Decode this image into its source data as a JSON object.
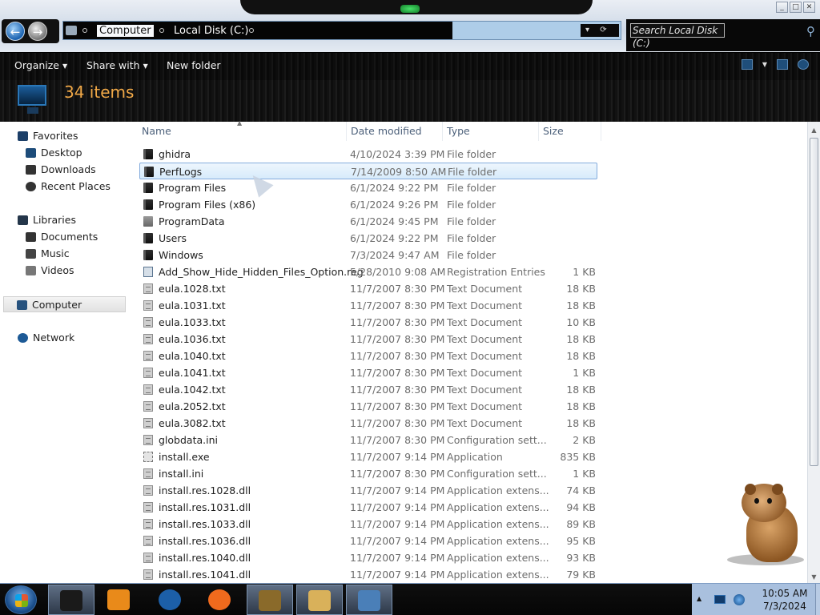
{
  "window": {
    "controls": {
      "minimize": "_",
      "maximize": "□",
      "close": "✕"
    }
  },
  "address": {
    "crumb_computer": "Computer",
    "crumb_drive": "Local Disk (C:)",
    "dropdown_glyph": "▾",
    "refresh_glyph": "⟳"
  },
  "search": {
    "placeholder": "Search Local Disk (C:)",
    "icon": "search-icon"
  },
  "toolbar": {
    "organize_label": "Organize",
    "share_label": "Share with",
    "newfolder_label": "New folder",
    "item_count": "34 items"
  },
  "nav": {
    "favorites": "Favorites",
    "desktop": "Desktop",
    "downloads": "Downloads",
    "recent_places": "Recent Places",
    "libraries": "Libraries",
    "documents": "Documents",
    "music": "Music",
    "videos": "Videos",
    "computer": "Computer",
    "network": "Network"
  },
  "columns": {
    "name": "Name",
    "date": "Date modified",
    "type": "Type",
    "size": "Size"
  },
  "files": [
    {
      "name": "ghidra",
      "date": "4/10/2024 3:39 PM",
      "type": "File folder",
      "size": "",
      "icon": "folder"
    },
    {
      "name": "PerfLogs",
      "date": "7/14/2009 8:50 AM",
      "type": "File folder",
      "size": "",
      "icon": "folder",
      "selected": true
    },
    {
      "name": "Program Files",
      "date": "6/1/2024 9:22 PM",
      "type": "File folder",
      "size": "",
      "icon": "folder"
    },
    {
      "name": "Program Files (x86)",
      "date": "6/1/2024 9:26 PM",
      "type": "File folder",
      "size": "",
      "icon": "folder"
    },
    {
      "name": "ProgramData",
      "date": "6/1/2024 9:45 PM",
      "type": "File folder",
      "size": "",
      "icon": "folderlight"
    },
    {
      "name": "Users",
      "date": "6/1/2024 9:22 PM",
      "type": "File folder",
      "size": "",
      "icon": "folder"
    },
    {
      "name": "Windows",
      "date": "7/3/2024 9:47 AM",
      "type": "File folder",
      "size": "",
      "icon": "folder"
    },
    {
      "name": "Add_Show_Hide_Hidden_Files_Option.reg",
      "date": "5/28/2010 9:08 AM",
      "type": "Registration Entries",
      "size": "1 KB",
      "icon": "reg"
    },
    {
      "name": "eula.1028.txt",
      "date": "11/7/2007 8:30 PM",
      "type": "Text Document",
      "size": "18 KB",
      "icon": "doc"
    },
    {
      "name": "eula.1031.txt",
      "date": "11/7/2007 8:30 PM",
      "type": "Text Document",
      "size": "18 KB",
      "icon": "doc"
    },
    {
      "name": "eula.1033.txt",
      "date": "11/7/2007 8:30 PM",
      "type": "Text Document",
      "size": "10 KB",
      "icon": "doc"
    },
    {
      "name": "eula.1036.txt",
      "date": "11/7/2007 8:30 PM",
      "type": "Text Document",
      "size": "18 KB",
      "icon": "doc"
    },
    {
      "name": "eula.1040.txt",
      "date": "11/7/2007 8:30 PM",
      "type": "Text Document",
      "size": "18 KB",
      "icon": "doc"
    },
    {
      "name": "eula.1041.txt",
      "date": "11/7/2007 8:30 PM",
      "type": "Text Document",
      "size": "1 KB",
      "icon": "doc"
    },
    {
      "name": "eula.1042.txt",
      "date": "11/7/2007 8:30 PM",
      "type": "Text Document",
      "size": "18 KB",
      "icon": "doc"
    },
    {
      "name": "eula.2052.txt",
      "date": "11/7/2007 8:30 PM",
      "type": "Text Document",
      "size": "18 KB",
      "icon": "doc"
    },
    {
      "name": "eula.3082.txt",
      "date": "11/7/2007 8:30 PM",
      "type": "Text Document",
      "size": "18 KB",
      "icon": "doc"
    },
    {
      "name": "globdata.ini",
      "date": "11/7/2007 8:30 PM",
      "type": "Configuration sett...",
      "size": "2 KB",
      "icon": "doc"
    },
    {
      "name": "install.exe",
      "date": "11/7/2007 9:14 PM",
      "type": "Application",
      "size": "835 KB",
      "icon": "exe"
    },
    {
      "name": "install.ini",
      "date": "11/7/2007 8:30 PM",
      "type": "Configuration sett...",
      "size": "1 KB",
      "icon": "doc"
    },
    {
      "name": "install.res.1028.dll",
      "date": "11/7/2007 9:14 PM",
      "type": "Application extens...",
      "size": "74 KB",
      "icon": "doc"
    },
    {
      "name": "install.res.1031.dll",
      "date": "11/7/2007 9:14 PM",
      "type": "Application extens...",
      "size": "94 KB",
      "icon": "doc"
    },
    {
      "name": "install.res.1033.dll",
      "date": "11/7/2007 9:14 PM",
      "type": "Application extens...",
      "size": "89 KB",
      "icon": "doc"
    },
    {
      "name": "install.res.1036.dll",
      "date": "11/7/2007 9:14 PM",
      "type": "Application extens...",
      "size": "95 KB",
      "icon": "doc"
    },
    {
      "name": "install.res.1040.dll",
      "date": "11/7/2007 9:14 PM",
      "type": "Application extens...",
      "size": "93 KB",
      "icon": "doc"
    },
    {
      "name": "install.res.1041.dll",
      "date": "11/7/2007 9:14 PM",
      "type": "Application extens...",
      "size": "79 KB",
      "icon": "doc"
    }
  ],
  "taskbar": {
    "apps": [
      {
        "name": "explorer-app",
        "color": "#1a1a1a"
      },
      {
        "name": "media-player-app",
        "color": "#e98a1a"
      },
      {
        "name": "globe-app",
        "color": "#1c5fa8"
      },
      {
        "name": "firefox-app",
        "color": "#f06a1d"
      },
      {
        "name": "hamster-box-app",
        "color": "#8a6a2a"
      },
      {
        "name": "file-manager-app",
        "color": "#d9b15a"
      },
      {
        "name": "network-computer-app",
        "color": "#4a7fb8"
      }
    ],
    "time": "10:05 AM",
    "date": "7/3/2024"
  }
}
